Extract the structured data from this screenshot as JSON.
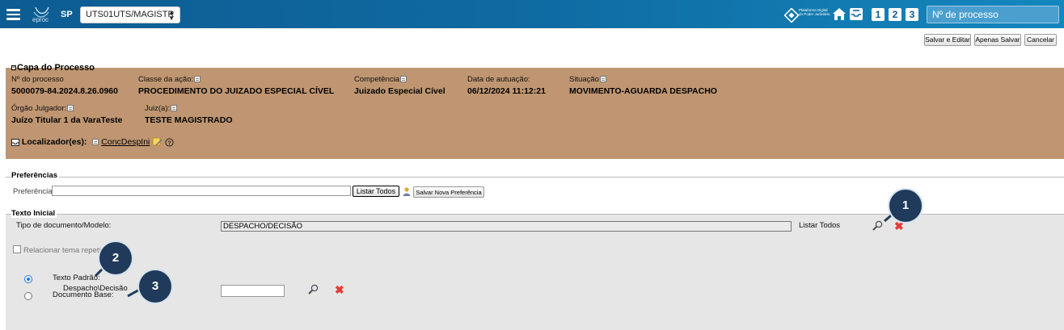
{
  "header": {
    "logo_text": "eproc",
    "state": "SP",
    "unit_selected": "UTS01UTS/MAGISTR",
    "pdpj_text": "Plataforma Digital do Poder Judiciário",
    "num_buttons": [
      "1",
      "2",
      "3"
    ],
    "process_search_placeholder": "Nº de processo",
    "bar_color": "#0f6ba2"
  },
  "actions": {
    "save_edit": "Salvar e Editar",
    "save_only": "Apenas Salvar",
    "cancel": "Cancelar"
  },
  "capa": {
    "title": "Capa do Processo",
    "background": "#bf9671",
    "fields": {
      "numero_label": "Nº do processo",
      "numero_value": "5000079-84.2024.8.26.0960",
      "classe_label": "Classe da ação:",
      "classe_value": "PROCEDIMENTO DO JUIZADO ESPECIAL CÍVEL",
      "competencia_label": "Competência",
      "competencia_value": "Juizado Especial Cível",
      "data_label": "Data de autuação:",
      "data_value": "06/12/2024 11:12:21",
      "situacao_label": "Situação",
      "situacao_value": "MOVIMENTO-AGUARDA DESPACHO",
      "orgao_label": "Órgão Julgador:",
      "orgao_value": "Juízo Titular 1 da VaraTeste",
      "juiz_label": "Juiz(a):",
      "juiz_value": "TESTE MAGISTRADO",
      "localizador_label": "Localizador(es):",
      "localizador_link": "ConcDespIni"
    }
  },
  "preferencias": {
    "legend": "Preferências",
    "field_label": "Preferência:",
    "field_value": "",
    "listar_todos": "Listar Todos",
    "salvar_nova": "Salvar Nova Preferência"
  },
  "texto_inicial": {
    "legend": "Texto Inicial",
    "tipo_label": "Tipo de documento/Modelo:",
    "tipo_value": "DESPACHO/DECISÃO",
    "listar_todos": "Listar Todos",
    "relacionar_label": "Relacionar tema repetitivo",
    "relacionar_checked": false,
    "texto_padrao_label": "Texto Padrão:",
    "texto_padrao_value": "Despacho\\Decisão",
    "texto_padrao_selected": true,
    "documento_base_label": "Documento Base:",
    "documento_base_value": ""
  },
  "callouts": [
    "1",
    "2",
    "3"
  ]
}
